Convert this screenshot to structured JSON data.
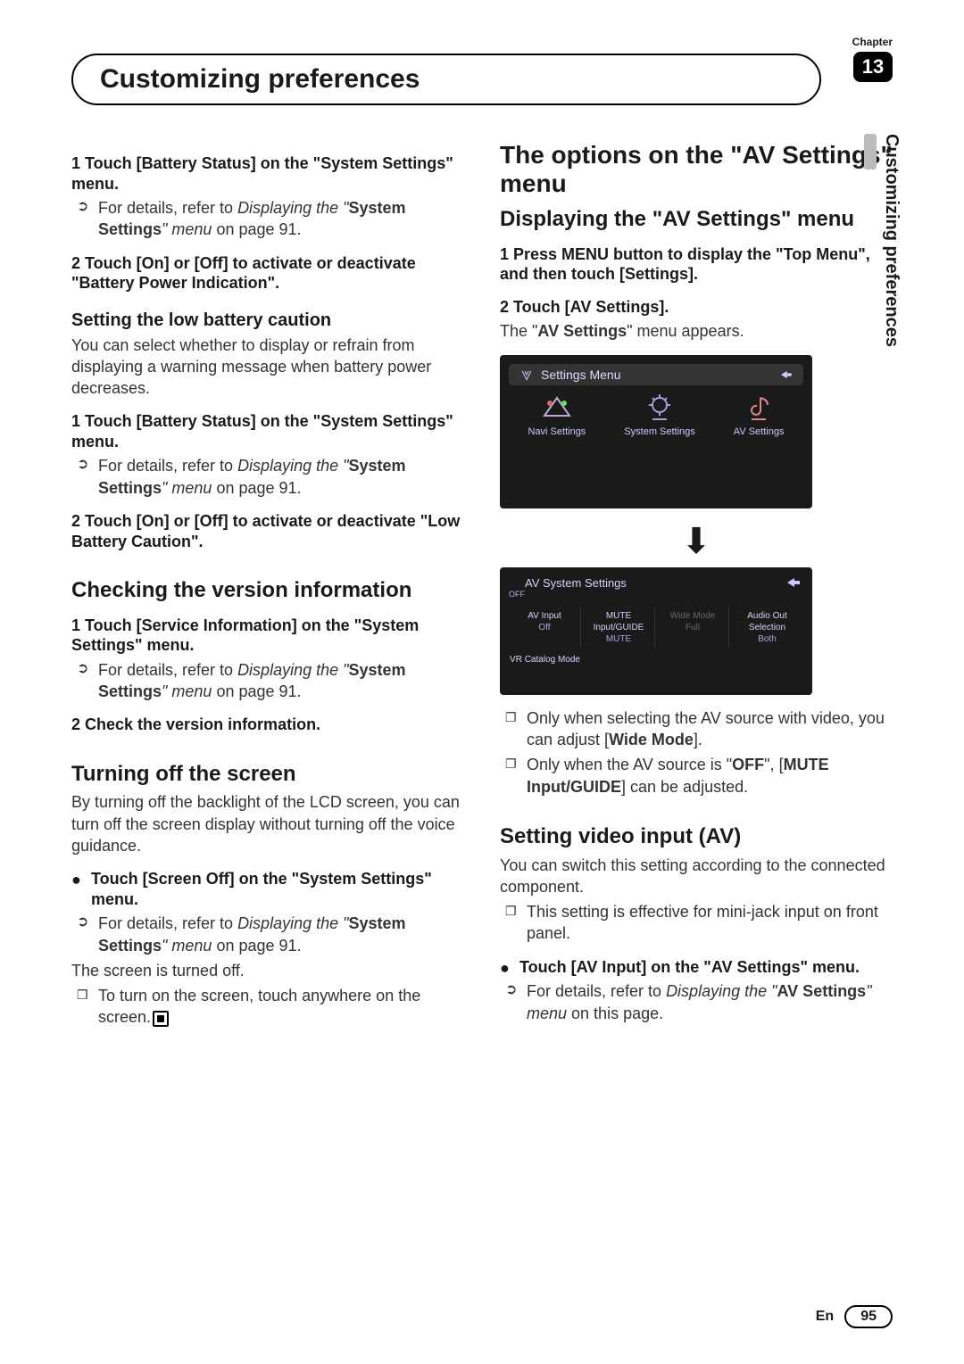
{
  "chapter_label": "Chapter",
  "chapter_number": "13",
  "page_title": "Customizing preferences",
  "side_tab": "Customizing preferences",
  "footer_lang": "En",
  "footer_page": "95",
  "left": {
    "s1": "1   Touch [Battery Status] on the \"System Settings\" menu.",
    "s1_ref_a": "For details, refer to ",
    "s1_ref_b": "Displaying the \"",
    "s1_ref_c": "System Settings",
    "s1_ref_d": "\" menu",
    "s1_ref_e": " on page 91.",
    "s2": "2   Touch [On] or [Off] to activate or deactivate \"Battery Power Indication\".",
    "h_low": "Setting the low battery caution",
    "low_body": "You can select whether to display or refrain from displaying a warning message when battery power decreases.",
    "low1": "1   Touch [Battery Status] on the \"System Settings\" menu.",
    "low2": "2   Touch [On] or [Off] to activate or deactivate \"Low Battery Caution\".",
    "h_ver": "Checking the version information",
    "ver1": "1   Touch [Service Information] on the \"System Settings\" menu.",
    "ver2": "2   Check the version information.",
    "h_off": "Turning off the screen",
    "off_body": "By turning off the backlight of the LCD screen, you can turn off the screen display without turning off the voice guidance.",
    "off_step": "Touch [Screen Off] on the \"System Settings\" menu.",
    "off_after": "The screen is turned off.",
    "off_note": "To turn on the screen, touch anywhere on the screen."
  },
  "right": {
    "h_av": "The options on the \"AV Settings\" menu",
    "h_disp": "Displaying the \"AV Settings\" menu",
    "d1": "1   Press MENU button to display the \"Top Menu\", and then touch [Settings].",
    "d2": "2   Touch [AV Settings].",
    "d2_body_a": "The \"",
    "d2_body_b": "AV Settings",
    "d2_body_c": "\" menu appears.",
    "scrn1_title": "Settings Menu",
    "scrn1_items": [
      "Navi Settings",
      "System Settings",
      "AV Settings"
    ],
    "scrn2_title": "AV System Settings",
    "scrn2_off": "OFF",
    "scrn2_headers": [
      "AV Input",
      "MUTE Input/GUIDE",
      "Wide Mode",
      "Audio Out Selection"
    ],
    "scrn2_values": [
      "Off",
      "MUTE",
      "Full",
      "Both"
    ],
    "scrn2_row2": "VR Catalog Mode",
    "note1_a": "Only when selecting the AV source with video, you can adjust [",
    "note1_b": "Wide Mode",
    "note1_c": "].",
    "note2_a": "Only when the AV source is \"",
    "note2_b": "OFF",
    "note2_c": "\", [",
    "note2_d": "MUTE Input/GUIDE",
    "note2_e": "] can be adjusted.",
    "h_vin": "Setting video input (AV)",
    "vin_body": "You can switch this setting according to the connected component.",
    "vin_note": "This setting is effective for mini-jack input on front panel.",
    "vin_step": "Touch [AV Input] on the \"AV Settings\" menu.",
    "vin_ref_a": "For details, refer to ",
    "vin_ref_b": "Displaying the \"",
    "vin_ref_c": "AV Settings",
    "vin_ref_d": "\" menu",
    "vin_ref_e": " on this page."
  }
}
